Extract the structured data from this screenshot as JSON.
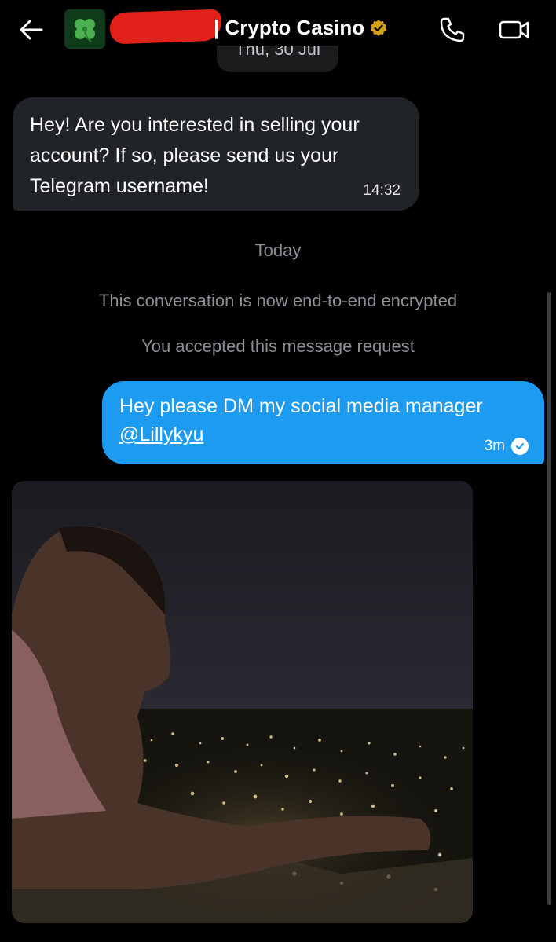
{
  "header": {
    "contact_name": "| Crypto Casino",
    "avatar_icon": "four-leaf-clover-icon",
    "verified_color": "#d4a017",
    "redacted_color": "#e3211b"
  },
  "date_chip": "Thu, 30 Jul",
  "messages": [
    {
      "direction": "incoming",
      "text": "Hey! Are you interested in selling your account? If so, please send us your Telegram username!",
      "time": "14:32"
    },
    {
      "direction": "outgoing",
      "text": "Hey please DM my social media manager",
      "mention": "@Lillykyu",
      "time": "3m",
      "status": "seen"
    }
  ],
  "day_separator": "Today",
  "system_notes": {
    "encrypted": "This conversation is now end-to-end encrypted",
    "accepted": "You accepted this message request"
  },
  "colors": {
    "background": "#000000",
    "incoming_bubble": "#202327",
    "outgoing_bubble": "#1d9bf0",
    "muted_text": "#8b9096"
  }
}
